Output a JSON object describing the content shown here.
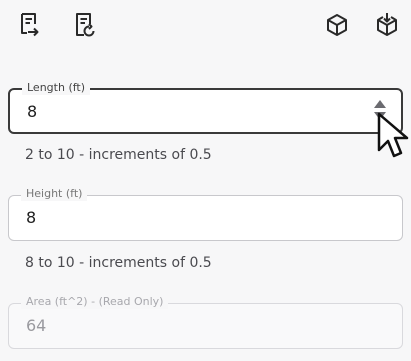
{
  "toolbar": {
    "icons": [
      "document-export-icon",
      "document-restore-icon",
      "cube-icon",
      "cube-download-icon"
    ]
  },
  "fields": {
    "length": {
      "label": "Length (ft)",
      "value": "8",
      "hint": "2 to 10 - increments of 0.5"
    },
    "height": {
      "label": "Height (ft)",
      "value": "8",
      "hint": "8 to 10 - increments of 0.5"
    },
    "area": {
      "label": "Area (ft^2) - (Read Only)",
      "value": "64"
    }
  },
  "colors": {
    "focus_border": "#3a3a3a",
    "border": "#c8c8cc",
    "readonly_text": "#9a9a9f"
  }
}
